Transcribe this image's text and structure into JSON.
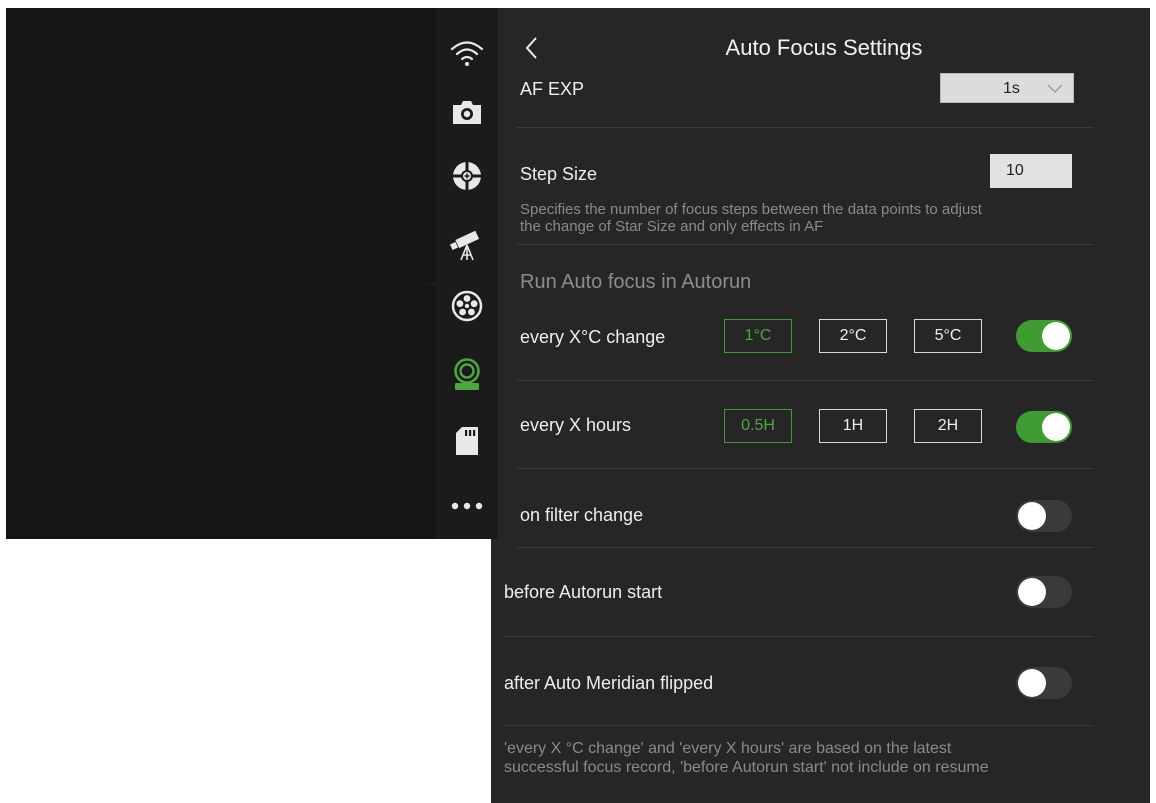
{
  "colors": {
    "accent": "#3f9b33",
    "panel": "#262626",
    "sidebar": "#1b1b1b",
    "viewport": "#151515"
  },
  "sidebar": {
    "items": [
      {
        "icon": "wifi-icon",
        "active": false
      },
      {
        "icon": "camera-icon",
        "active": false
      },
      {
        "icon": "crosshair-icon",
        "active": false
      },
      {
        "icon": "telescope-icon",
        "active": false
      },
      {
        "icon": "filter-wheel-icon",
        "active": false
      },
      {
        "icon": "focuser-icon",
        "active": true
      },
      {
        "icon": "sd-card-icon",
        "active": false
      },
      {
        "icon": "more-icon",
        "active": false
      }
    ]
  },
  "header": {
    "title": "Auto Focus Settings",
    "back_icon": "chevron-left-icon"
  },
  "af_exp": {
    "label": "AF EXP",
    "value": "1s"
  },
  "step_size": {
    "label": "Step Size",
    "value": "10",
    "description_line1": "Specifies the number of focus steps between the data points to adjust",
    "description_line2": "the change of Star Size and only effects in AF"
  },
  "autorun": {
    "heading": "Run Auto focus in Autorun",
    "temp": {
      "label": "every X°C change",
      "options": [
        "1°C",
        "2°C",
        "5°C"
      ],
      "selected": "1°C",
      "enabled": true
    },
    "hours": {
      "label": "every X hours",
      "options": [
        "0.5H",
        "1H",
        "2H"
      ],
      "selected": "0.5H",
      "enabled": true
    },
    "filter": {
      "label": "on filter change",
      "enabled": false
    },
    "before": {
      "label": "before Autorun start",
      "enabled": false
    },
    "meridian": {
      "label": "after Auto Meridian flipped",
      "enabled": false
    },
    "note_line1": "'every X °C change' and 'every X hours' are based on the latest",
    "note_line2": "successful focus record, 'before Autorun start' not include on resume"
  }
}
